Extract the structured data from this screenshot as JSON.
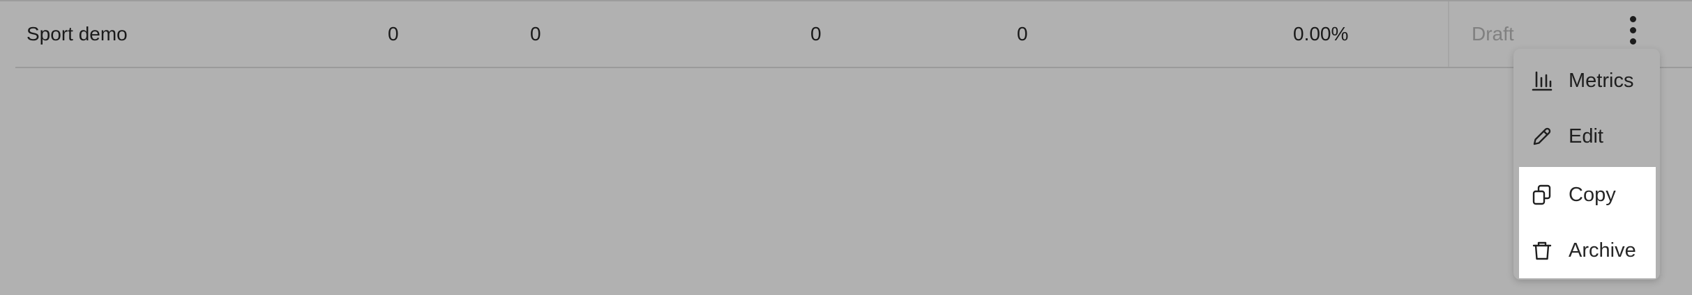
{
  "row": {
    "name": "Sport demo",
    "values": [
      "0",
      "0",
      "0",
      "0"
    ],
    "rate": "0.00%",
    "status": "Draft"
  },
  "menu": {
    "items": [
      {
        "label": "Metrics",
        "icon": "bar-chart-icon"
      },
      {
        "label": "Edit",
        "icon": "pencil-icon"
      },
      {
        "label": "Copy",
        "icon": "copy-icon"
      },
      {
        "label": "Archive",
        "icon": "trash-icon"
      }
    ]
  }
}
